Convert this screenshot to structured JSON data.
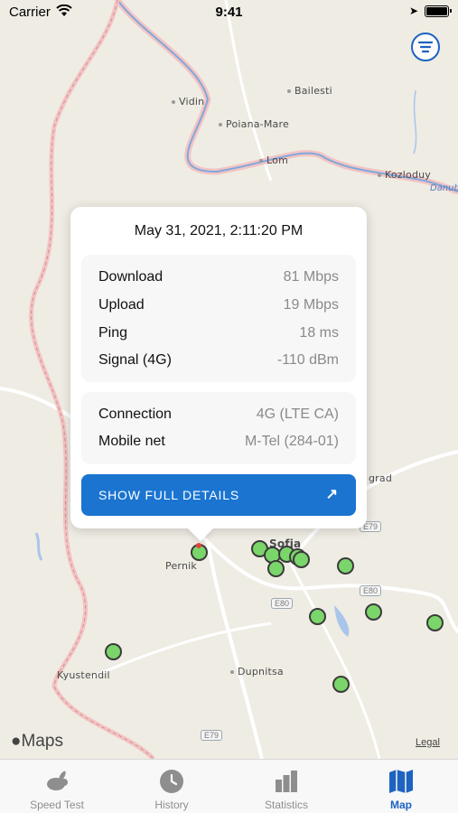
{
  "status_bar": {
    "carrier": "Carrier",
    "time": "9:41"
  },
  "map": {
    "places": [
      {
        "name": "Bailesti",
        "cls": "p-bailesti"
      },
      {
        "name": "Vidin",
        "cls": "p-vidin"
      },
      {
        "name": "Poiana-Mare",
        "cls": "p-poiana"
      },
      {
        "name": "Lom",
        "cls": "p-lom"
      },
      {
        "name": "Kozloduy",
        "cls": "p-kozloduy"
      },
      {
        "name": "Pernik",
        "cls": "p-pernik"
      },
      {
        "name": "Sofia",
        "cls": "p-sofia"
      },
      {
        "name": "Kyustendil",
        "cls": "p-kyustendil"
      },
      {
        "name": "Dupnitsa",
        "cls": "p-dupnitsa"
      },
      {
        "name": "grad",
        "cls": "p-grad"
      }
    ],
    "river": "Danube",
    "road_badges": [
      "E79",
      "E80",
      "E80",
      "E79"
    ],
    "attribution": "Maps",
    "legal": "Legal"
  },
  "popup": {
    "title": "May 31, 2021, 2:11:20 PM",
    "metrics": [
      {
        "label": "Download",
        "value": "81 Mbps"
      },
      {
        "label": "Upload",
        "value": "19 Mbps"
      },
      {
        "label": "Ping",
        "value": "18 ms"
      },
      {
        "label": "Signal (4G)",
        "value": "-110 dBm"
      }
    ],
    "network": [
      {
        "label": "Connection",
        "value": "4G (LTE CA)"
      },
      {
        "label": "Mobile net",
        "value": "M-Tel (284-01)"
      }
    ],
    "button_label": "SHOW FULL DETAILS",
    "button_color": "#1a74d0"
  },
  "tabs": [
    {
      "label": "Speed Test",
      "icon": "rabbit-icon",
      "active": false
    },
    {
      "label": "History",
      "icon": "history-icon",
      "active": false
    },
    {
      "label": "Statistics",
      "icon": "bar-chart-icon",
      "active": false
    },
    {
      "label": "Map",
      "icon": "map-icon",
      "active": true
    }
  ],
  "colors": {
    "accent": "#1d63c0",
    "marker": "#7ad66a",
    "selected_marker": "#e8453c"
  }
}
